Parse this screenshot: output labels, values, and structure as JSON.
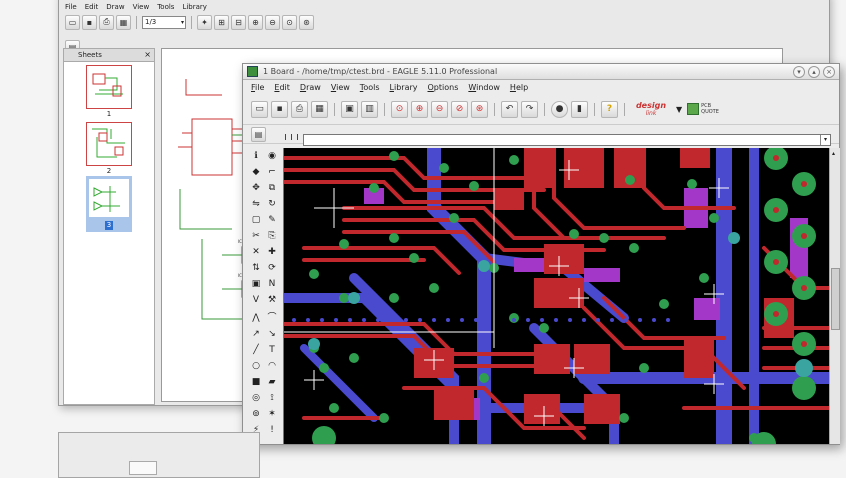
{
  "back_window": {
    "menu": [
      "File",
      "Edit",
      "Draw",
      "View",
      "Tools",
      "Library"
    ],
    "zoom_value": "1/3",
    "sheets_title": "Sheets",
    "sheets": [
      {
        "number": "1"
      },
      {
        "number": "2"
      },
      {
        "number": "3"
      }
    ]
  },
  "front_window": {
    "title": "1 Board - /home/tmp/ctest.brd - EAGLE 5.11.0 Professional",
    "menu": [
      "File",
      "Edit",
      "Draw",
      "View",
      "Tools",
      "Library",
      "Options",
      "Window",
      "Help"
    ],
    "logo_design_line1": "design",
    "logo_design_line2": "link",
    "logo_pcb_line1": "PCB",
    "logo_pcb_line2": "QUOTE",
    "help_glyph": "?"
  },
  "colors": {
    "board_bg": "#000000",
    "top_copper": "#c0282d",
    "bottom_copper": "#4a4acf",
    "via_ring": "#2f9e4f",
    "pad_highlight": "#a237c8",
    "selection_bg": "#a9c6ea"
  },
  "icons": {
    "toolbar": [
      "open-icon",
      "save-icon",
      "print-icon",
      "cam-icon",
      "zoom-fit-icon",
      "zoom-in-icon",
      "zoom-out-icon",
      "undo-icon",
      "redo-icon",
      "stop-icon",
      "go-icon",
      "help-icon"
    ]
  }
}
